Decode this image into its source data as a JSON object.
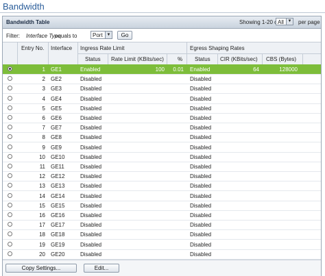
{
  "page": {
    "title": "Bandwidth"
  },
  "panel": {
    "title": "Bandwidth Table",
    "showing": "Showing 1-20 of 20",
    "per_page_value": "All",
    "per_page_label": "per page"
  },
  "filter": {
    "label": "Filter:",
    "field": "Interface Type",
    "operator": "equals to",
    "value": "Port",
    "go_label": "Go"
  },
  "columns": {
    "entry_no": "Entry No.",
    "interface": "Interface",
    "ingress_group": "Ingress Rate Limit",
    "egress_group": "Egress Shaping Rates",
    "status": "Status",
    "rate_limit": "Rate Limit (KBits/sec)",
    "percent": "%",
    "egress_status": "Status",
    "cir": "CIR (KBits/sec)",
    "cbs": "CBS (Bytes)"
  },
  "rows": [
    {
      "entry": "1",
      "iface": "GE1",
      "ingress": "Enabled",
      "rate": "100",
      "pct": "0.01",
      "egress": "Enabled",
      "cir": "64",
      "cbs": "128000",
      "selected": true
    },
    {
      "entry": "2",
      "iface": "GE2",
      "ingress": "Disabled",
      "rate": "",
      "pct": "",
      "egress": "Disabled",
      "cir": "",
      "cbs": ""
    },
    {
      "entry": "3",
      "iface": "GE3",
      "ingress": "Disabled",
      "rate": "",
      "pct": "",
      "egress": "Disabled",
      "cir": "",
      "cbs": ""
    },
    {
      "entry": "4",
      "iface": "GE4",
      "ingress": "Disabled",
      "rate": "",
      "pct": "",
      "egress": "Disabled",
      "cir": "",
      "cbs": ""
    },
    {
      "entry": "5",
      "iface": "GE5",
      "ingress": "Disabled",
      "rate": "",
      "pct": "",
      "egress": "Disabled",
      "cir": "",
      "cbs": ""
    },
    {
      "entry": "6",
      "iface": "GE6",
      "ingress": "Disabled",
      "rate": "",
      "pct": "",
      "egress": "Disabled",
      "cir": "",
      "cbs": ""
    },
    {
      "entry": "7",
      "iface": "GE7",
      "ingress": "Disabled",
      "rate": "",
      "pct": "",
      "egress": "Disabled",
      "cir": "",
      "cbs": ""
    },
    {
      "entry": "8",
      "iface": "GE8",
      "ingress": "Disabled",
      "rate": "",
      "pct": "",
      "egress": "Disabled",
      "cir": "",
      "cbs": ""
    },
    {
      "entry": "9",
      "iface": "GE9",
      "ingress": "Disabled",
      "rate": "",
      "pct": "",
      "egress": "Disabled",
      "cir": "",
      "cbs": ""
    },
    {
      "entry": "10",
      "iface": "GE10",
      "ingress": "Disabled",
      "rate": "",
      "pct": "",
      "egress": "Disabled",
      "cir": "",
      "cbs": ""
    },
    {
      "entry": "11",
      "iface": "GE11",
      "ingress": "Disabled",
      "rate": "",
      "pct": "",
      "egress": "Disabled",
      "cir": "",
      "cbs": ""
    },
    {
      "entry": "12",
      "iface": "GE12",
      "ingress": "Disabled",
      "rate": "",
      "pct": "",
      "egress": "Disabled",
      "cir": "",
      "cbs": ""
    },
    {
      "entry": "13",
      "iface": "GE13",
      "ingress": "Disabled",
      "rate": "",
      "pct": "",
      "egress": "Disabled",
      "cir": "",
      "cbs": ""
    },
    {
      "entry": "14",
      "iface": "GE14",
      "ingress": "Disabled",
      "rate": "",
      "pct": "",
      "egress": "Disabled",
      "cir": "",
      "cbs": ""
    },
    {
      "entry": "15",
      "iface": "GE15",
      "ingress": "Disabled",
      "rate": "",
      "pct": "",
      "egress": "Disabled",
      "cir": "",
      "cbs": ""
    },
    {
      "entry": "16",
      "iface": "GE16",
      "ingress": "Disabled",
      "rate": "",
      "pct": "",
      "egress": "Disabled",
      "cir": "",
      "cbs": ""
    },
    {
      "entry": "17",
      "iface": "GE17",
      "ingress": "Disabled",
      "rate": "",
      "pct": "",
      "egress": "Disabled",
      "cir": "",
      "cbs": ""
    },
    {
      "entry": "18",
      "iface": "GE18",
      "ingress": "Disabled",
      "rate": "",
      "pct": "",
      "egress": "Disabled",
      "cir": "",
      "cbs": ""
    },
    {
      "entry": "19",
      "iface": "GE19",
      "ingress": "Disabled",
      "rate": "",
      "pct": "",
      "egress": "Disabled",
      "cir": "",
      "cbs": ""
    },
    {
      "entry": "20",
      "iface": "GE20",
      "ingress": "Disabled",
      "rate": "",
      "pct": "",
      "egress": "Disabled",
      "cir": "",
      "cbs": ""
    }
  ],
  "footer": {
    "copy_label": "Copy Settings...",
    "edit_label": "Edit..."
  }
}
